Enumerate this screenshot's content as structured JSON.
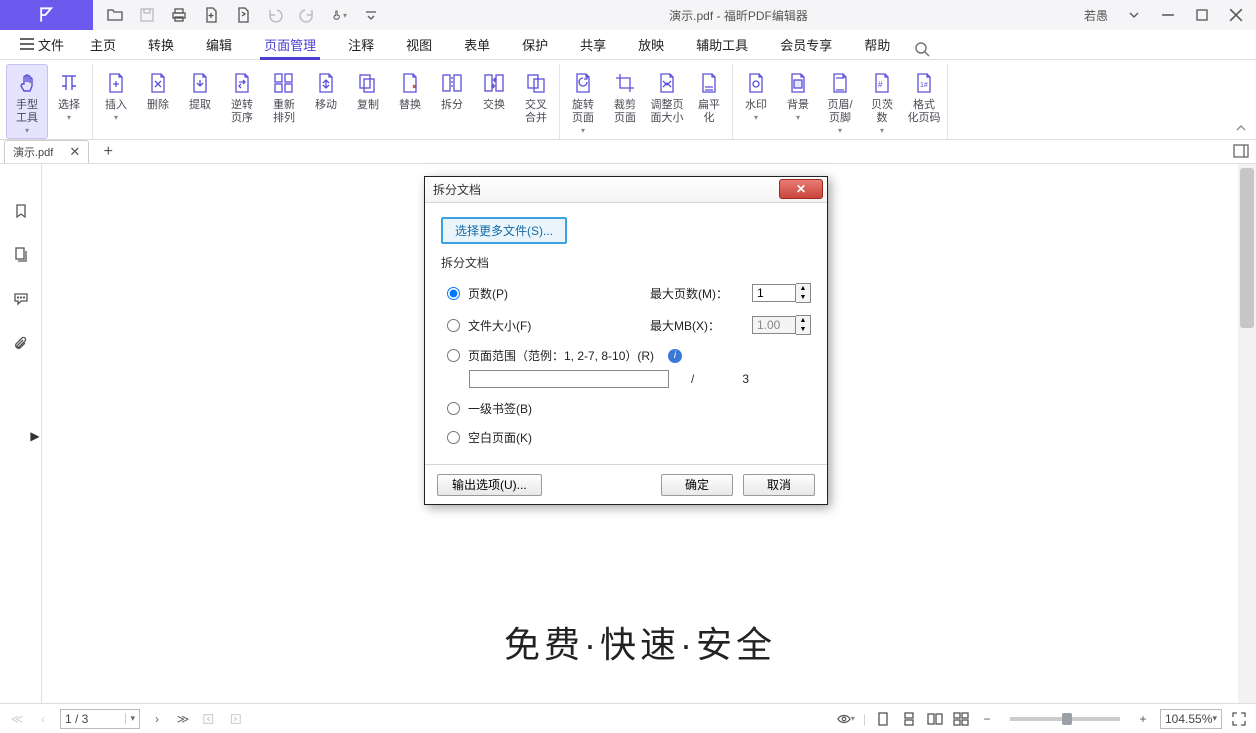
{
  "colors": {
    "accent": "#6b5aed"
  },
  "title": "演示.pdf - 福昕PDF编辑器",
  "user": {
    "name": "若愚"
  },
  "file_menu": "文件",
  "tabs": [
    "主页",
    "转换",
    "编辑",
    "页面管理",
    "注释",
    "视图",
    "表单",
    "保护",
    "共享",
    "放映",
    "辅助工具",
    "会员专享",
    "帮助"
  ],
  "active_tab_index": 3,
  "ribbon": {
    "groups": [
      [
        {
          "label": "手型",
          "label2": "工具",
          "active": true,
          "caret": true
        },
        {
          "label": "选择",
          "caret": true
        }
      ],
      [
        {
          "label": "插入",
          "caret": true
        },
        {
          "label": "删除"
        },
        {
          "label": "提取"
        },
        {
          "label": "逆转",
          "label2": "页序"
        },
        {
          "label": "重新",
          "label2": "排列"
        },
        {
          "label": "移动"
        },
        {
          "label": "复制"
        },
        {
          "label": "替换"
        },
        {
          "label": "拆分"
        },
        {
          "label": "交换"
        },
        {
          "label": "交叉",
          "label2": "合并"
        }
      ],
      [
        {
          "label": "旋转",
          "label2": "页面",
          "caret": true
        },
        {
          "label": "裁剪",
          "label2": "页面"
        },
        {
          "label": "调整页",
          "label2": "面大小"
        },
        {
          "label": "扁平",
          "label2": "化"
        }
      ],
      [
        {
          "label": "水印",
          "caret": true
        },
        {
          "label": "背景",
          "caret": true
        },
        {
          "label": "页眉/",
          "label2": "页脚",
          "caret": true
        },
        {
          "label": "贝茨",
          "label2": "数",
          "caret": true
        },
        {
          "label": "格式",
          "label2": "化页码"
        }
      ]
    ]
  },
  "doc_tab": {
    "label": "演示.pdf"
  },
  "page_content": {
    "banner": "免费·快速·安全"
  },
  "dialog": {
    "title": "拆分文档",
    "more_files": "选择更多文件(S)...",
    "group_label": "拆分文档",
    "opts": {
      "pages": {
        "label": "页数(P)",
        "max_label": "最大页数(M)：",
        "value": "1"
      },
      "filesize": {
        "label": "文件大小(F)",
        "max_label": "最大MB(X)：",
        "value": "1.00"
      },
      "range": {
        "label": "页面范围（范例：1, 2-7, 8-10）(R)",
        "value": "",
        "sep": "/",
        "total": "3"
      },
      "bookmark": {
        "label": "一级书签(B)"
      },
      "blank": {
        "label": "空白页面(K)"
      },
      "selected": "pages"
    },
    "output_btn": "输出选项(U)...",
    "ok": "确定",
    "cancel": "取消"
  },
  "status": {
    "page": "1 / 3",
    "zoom": "104.55%"
  }
}
